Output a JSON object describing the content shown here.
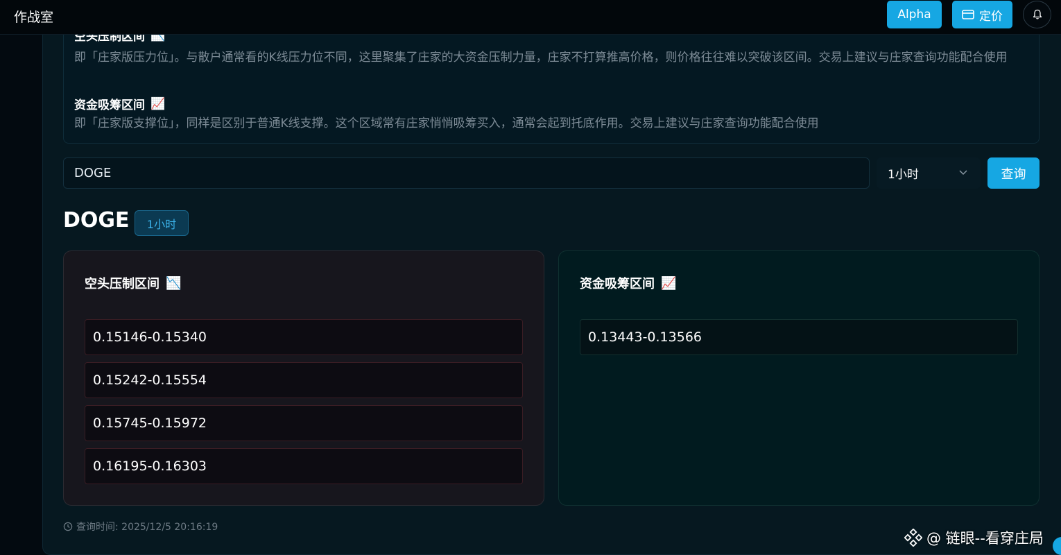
{
  "header": {
    "title": "作战室",
    "alpha_label": "Alpha",
    "pricing_label": "定价"
  },
  "info": {
    "short_title": "空头压制区间",
    "short_icon": "📉",
    "short_desc": "即「庄家版压力位」。与散户通常看的K线压力位不同，这里聚集了庄家的大资金压制力量，庄家不打算推高价格，则价格往往难以突破该区间。交易上建议与庄家查询功能配合使用",
    "long_title": "资金吸筹区间",
    "long_icon": "📈",
    "long_desc": "即「庄家版支撑位」，同样是区别于普通K线支撑。这个区域常有庄家悄悄吸筹买入，通常会起到托底作用。交易上建议与庄家查询功能配合使用"
  },
  "search": {
    "value": "DOGE",
    "interval_selected": "1小时",
    "query_label": "查询"
  },
  "result": {
    "symbol": "DOGE",
    "interval_badge": "1小时",
    "short_card": {
      "title": "空头压制区间",
      "icon": "📉",
      "ranges": [
        "0.15146-0.15340",
        "0.15242-0.15554",
        "0.15745-0.15972",
        "0.16195-0.16303"
      ]
    },
    "long_card": {
      "title": "资金吸筹区间",
      "icon": "📈",
      "ranges": [
        "0.13443-0.13566"
      ]
    },
    "query_time": "查询时间: 2025/12/5 20:16:19"
  },
  "watermark": "@ 链眼--看穿庄局",
  "colors": {
    "accent": "#16a7e3",
    "background": "#030a10",
    "panel": "#061820"
  }
}
